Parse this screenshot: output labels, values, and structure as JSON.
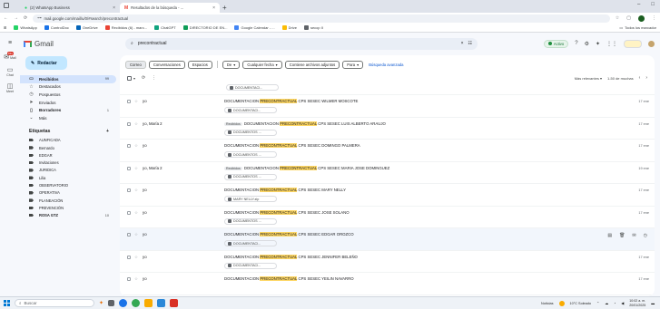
{
  "browser": {
    "tabs": [
      {
        "title": "(2) WhatsApp Business",
        "active": false
      },
      {
        "title": "Resultados de la búsqueda - ...",
        "active": true
      }
    ],
    "new_tab_icon": "plus-icon",
    "url": "mail.google.com/mail/u/0/#search/precontractual",
    "bookmarks": [
      {
        "label": "WhatsApp",
        "color": "#25d366"
      },
      {
        "label": "ControlDoc",
        "color": "#1a73e8"
      },
      {
        "label": "OneDrive",
        "color": "#0364b8"
      },
      {
        "label": "Recibidos (6) - marc...",
        "color": "#ea4335"
      },
      {
        "label": "ChatGPT",
        "color": "#10a37f"
      },
      {
        "label": "DIRECTORIO DE EN...",
        "color": "#0f9d58"
      },
      {
        "label": "Google Calendar - ...",
        "color": "#4285f4"
      },
      {
        "label": "Drive",
        "color": "#fbbc04"
      },
      {
        "label": "secop II",
        "color": "#5f6368"
      }
    ],
    "bookmarks_right": "Todos los marcador"
  },
  "gmail": {
    "logo_text": "Gmail",
    "search_query": "precontractual",
    "status": "Activo",
    "compose_label": "Redactar",
    "rail": [
      {
        "label": "Mail",
        "badge": "99+"
      },
      {
        "label": "Chat",
        "badge": ""
      },
      {
        "label": "Meet",
        "badge": ""
      }
    ],
    "nav": [
      {
        "label": "Recibidos",
        "count": "99",
        "icon": "inbox-icon",
        "active": true
      },
      {
        "label": "Destacados",
        "count": "",
        "icon": "star-icon",
        "active": false
      },
      {
        "label": "Pospuestos",
        "count": "",
        "icon": "clock-icon",
        "active": false
      },
      {
        "label": "Enviados",
        "count": "",
        "icon": "send-icon",
        "active": false
      },
      {
        "label": "Borradores",
        "count": "1",
        "icon": "draft-icon",
        "active": false
      },
      {
        "label": "Más",
        "count": "",
        "icon": "chevron-down-icon",
        "active": false
      }
    ],
    "labels_heading": "Etiquetas",
    "labels": [
      {
        "label": "AUNFICADA",
        "bold": false
      },
      {
        "label": "Bernardo",
        "bold": false
      },
      {
        "label": "EDGAR",
        "bold": false
      },
      {
        "label": "Invitaciones",
        "bold": false
      },
      {
        "label": "JURIDICA",
        "bold": false
      },
      {
        "label": "Lilia",
        "bold": false
      },
      {
        "label": "OBSERVATORIO",
        "bold": false
      },
      {
        "label": "OPERATIVA",
        "bold": false
      },
      {
        "label": "PLANEACIÓN",
        "bold": false
      },
      {
        "label": "PREVENCIÓN",
        "bold": false
      },
      {
        "label": "ROSA GTZ",
        "bold": true
      }
    ],
    "labels_last_count": "10",
    "filters": {
      "correo": "Correo",
      "conversaciones": "Conversaciones",
      "espacios": "Espacios",
      "de": "De",
      "fecha": "Cualquier fecha",
      "adjuntos": "Contiene archivos adjuntos",
      "para": "Para",
      "advanced": "Búsqueda avanzada"
    },
    "toolbar_right": "Más relevantes",
    "pagination": "1-50 de muchas",
    "rows": [
      {
        "sender": "",
        "tag": "",
        "pre": "",
        "hl": "",
        "post": "",
        "attachment": "DOCUMENTACI...",
        "date": ""
      },
      {
        "sender": "yo",
        "tag": "",
        "pre": "DOCUMENTACION ",
        "hl": "PRECONTRACTUAL",
        "post": " CPS SESEC WILMER MOSCOTE",
        "attachment": "DOCUMENTACI...",
        "date": "17 ene"
      },
      {
        "sender": "yo, María 2",
        "tag": "Recibidos",
        "pre": "DOCUMENTACION ",
        "hl": "PRECONTRACTUAL",
        "post": " CPS SESEC LUIS ALBERTO ARAUJO",
        "attachment": "DOCUMENTOS ...",
        "date": "17 ene"
      },
      {
        "sender": "yo",
        "tag": "",
        "pre": "DOCUMENTACION ",
        "hl": "PRECONTRACTUAL",
        "post": " CPS SESEC DOMINGO PALMERA",
        "attachment": "DOCUMENTOS ...",
        "date": "17 ene"
      },
      {
        "sender": "yo, María 2",
        "tag": "Recibidos",
        "pre": "DOCUMENTACION ",
        "hl": "PRECONTRACTUAL",
        "post": " CPS SESEC MARIA JOSE DOMINGUEZ",
        "attachment": "DOCUMENTOS ...",
        "date": "19 ene"
      },
      {
        "sender": "yo",
        "tag": "",
        "pre": "DOCUMENTACION ",
        "hl": "PRECONTRACTUAL",
        "post": " CPS SESEC MARY NELLY",
        "attachment": "MARY NELLY.zip",
        "date": "17 ene"
      },
      {
        "sender": "yo",
        "tag": "",
        "pre": "DOCUMENTACION ",
        "hl": "PRECONTRACTUAL",
        "post": " CPS SESEC JOSE SOLANO",
        "attachment": "DOCUMENTOS ...",
        "date": "17 ene"
      },
      {
        "sender": "yo",
        "tag": "",
        "pre": "DOCUMENTACION ",
        "hl": "PRECONTRACTUAL",
        "post": " CPS SESEC EDGAR OROZCO",
        "attachment": "DOCUMENTACI...",
        "date": ""
      },
      {
        "sender": "yo",
        "tag": "",
        "pre": "DOCUMENTACION ",
        "hl": "PRECONTRACTUAL",
        "post": " CPS SESEC JENNIFER BELEÑO",
        "attachment": "DOCUMENTACI...",
        "date": "17 ene"
      },
      {
        "sender": "yo",
        "tag": "",
        "pre": "DOCUMENTACION ",
        "hl": "PRECONTRACTUAL",
        "post": " CPS SESEC YEILIN NAVARRO",
        "attachment": "",
        "date": "17 ene"
      }
    ]
  },
  "taskbar": {
    "search_placeholder": "Buscar",
    "apps": [
      "#e8710a",
      "#0078d4",
      "#1a73e8",
      "#34a853",
      "#2b88d8",
      "#d93025"
    ],
    "news": "Noticias",
    "weather": "10°C Soleado",
    "time": "10:02 a. m.",
    "date": "20/01/2025"
  },
  "colors": {
    "accent": "#0b57d0",
    "highlight": "#fdd663",
    "compose": "#c2e7ff",
    "active_nav": "#d3e3fd"
  }
}
